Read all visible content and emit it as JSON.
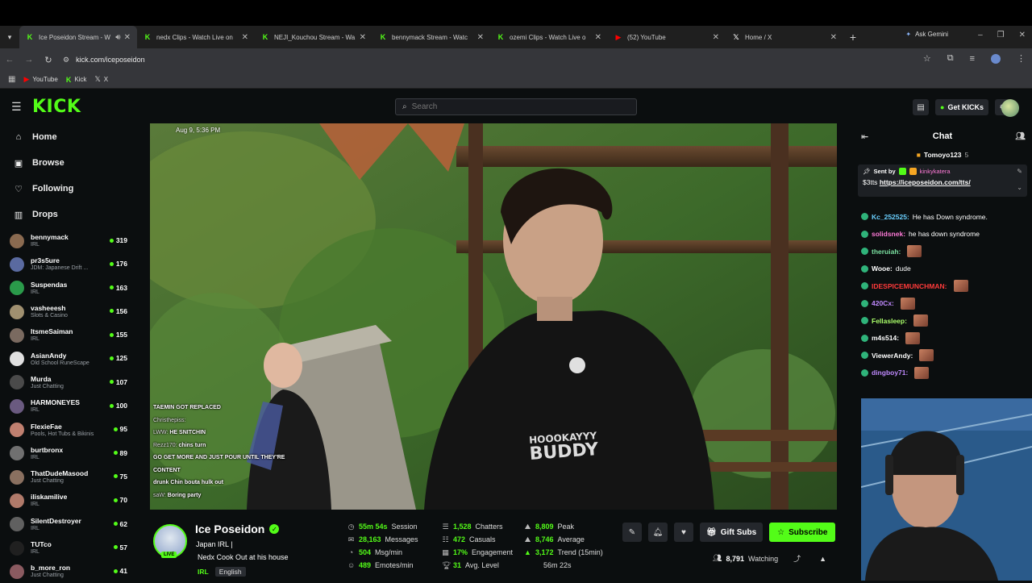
{
  "browser": {
    "tabs": [
      {
        "title": "Ice Poseidon Stream - W",
        "favicon": "kick-icon",
        "color": "#53fc18",
        "active": true
      },
      {
        "title": "nedx Clips - Watch Live on",
        "favicon": "kick-icon",
        "color": "#53fc18",
        "active": false
      },
      {
        "title": "NEJI_Kouchou Stream - Wa",
        "favicon": "kick-icon",
        "color": "#53fc18",
        "active": false
      },
      {
        "title": "bennymack Stream - Watc",
        "favicon": "kick-icon",
        "color": "#53fc18",
        "active": false
      },
      {
        "title": "ozemi Clips - Watch Live o",
        "favicon": "kick-icon",
        "color": "#53fc18",
        "active": false
      },
      {
        "title": "(52) YouTube",
        "favicon": "youtube-icon",
        "color": "#ff0000",
        "active": false
      },
      {
        "title": "Home / X",
        "favicon": "x-icon",
        "color": "#ffffff",
        "active": false
      }
    ],
    "ask_label": "Ask Gemini",
    "url": "kick.com/iceposeidon",
    "bookmarks": [
      "YouTube",
      "Kick",
      "X"
    ]
  },
  "kick": {
    "logo": "KICK",
    "search_placeholder": "Search",
    "get_kicks": "Get KICKs"
  },
  "sidebar": {
    "nav": [
      {
        "label": "Home",
        "icon": "home-icon"
      },
      {
        "label": "Browse",
        "icon": "browse-icon"
      },
      {
        "label": "Following",
        "icon": "heart-icon"
      },
      {
        "label": "Drops",
        "icon": "drops-icon"
      }
    ],
    "channels": [
      {
        "name": "bennymack",
        "category": "IRL",
        "viewers": "319",
        "color": "#8a6a50"
      },
      {
        "name": "pr3s5ure",
        "category": "JDM: Japanese Drift ...",
        "viewers": "176",
        "color": "#5a6aa0"
      },
      {
        "name": "Suspendas",
        "category": "IRL",
        "viewers": "163",
        "color": "#2a9a4a"
      },
      {
        "name": "vasheeesh",
        "category": "Slots & Casino",
        "viewers": "156",
        "color": "#a09070"
      },
      {
        "name": "ItsmeSaiman",
        "category": "IRL",
        "viewers": "155",
        "color": "#7a6a60"
      },
      {
        "name": "AsianAndy",
        "category": "Old School RuneScape",
        "viewers": "125",
        "color": "#e0e0e0"
      },
      {
        "name": "Murda",
        "category": "Just Chatting",
        "viewers": "107",
        "color": "#4a4a4a"
      },
      {
        "name": "HARMONEYES",
        "category": "IRL",
        "viewers": "100",
        "color": "#6a5a80"
      },
      {
        "name": "FlexieFae",
        "category": "Pools, Hot Tubs & Bikinis",
        "viewers": "95",
        "color": "#c08070"
      },
      {
        "name": "burtbronx",
        "category": "IRL",
        "viewers": "89",
        "color": "#707070"
      },
      {
        "name": "ThatDudeMasood",
        "category": "Just Chatting",
        "viewers": "75",
        "color": "#8a7060"
      },
      {
        "name": "iliskamilive",
        "category": "IRL",
        "viewers": "70",
        "color": "#b07a6a"
      },
      {
        "name": "SilentDestroyer",
        "category": "IRL",
        "viewers": "62",
        "color": "#606060"
      },
      {
        "name": "TUTco",
        "category": "IRL",
        "viewers": "57",
        "color": "#202020"
      },
      {
        "name": "b_more_ron",
        "category": "Just Chatting",
        "viewers": "41",
        "color": "#8a5a60"
      }
    ]
  },
  "player": {
    "timestamp": "Aug 9, 5:36 PM",
    "shirt_line1": "HOOOKAYYY",
    "shirt_line2": "BUDDY",
    "overlay_chat": [
      {
        "user": "",
        "text": "TAEMIN GOT REPLACED"
      },
      {
        "user": "Christhepiss:",
        "text": ""
      },
      {
        "user": "LWW:",
        "text": "HE SNITCHIN"
      },
      {
        "user": "Rezz170:",
        "text": "chins turn"
      },
      {
        "user": "",
        "text": "GO GET MORE AND JUST POUR UNTIL THEY'RE"
      },
      {
        "user": "",
        "text": "CONTENT"
      },
      {
        "user": "",
        "text": "drunk Chin bouta hulk out"
      },
      {
        "user": "saW:",
        "text": "Boring party"
      }
    ]
  },
  "stream": {
    "name": "Ice Poseidon",
    "live_badge": "LIVE",
    "title_line1": "Japan IRL |",
    "title_line2": "Nedx Cook Out at his house",
    "tags": [
      "IRL",
      "English"
    ],
    "stats_col1": [
      {
        "value": "55m 54s",
        "label": "Session",
        "icon": "clock-icon"
      },
      {
        "value": "28,163",
        "label": "Messages",
        "icon": "message-icon"
      },
      {
        "value": "504",
        "label": "Msg/min",
        "icon": "speed-icon"
      },
      {
        "value": "489",
        "label": "Emotes/min",
        "icon": "emote-icon"
      }
    ],
    "stats_col2": [
      {
        "value": "1,528",
        "label": "Chatters",
        "icon": "chatters-icon"
      },
      {
        "value": "472",
        "label": "Casuals",
        "icon": "casuals-icon"
      },
      {
        "value": "17%",
        "label": "Engagement",
        "icon": "engagement-icon"
      },
      {
        "value": "31",
        "label": "Avg. Level",
        "icon": "trophy-icon"
      }
    ],
    "stats_col3": [
      {
        "value": "8,809",
        "label": "Peak",
        "icon": "peak-icon"
      },
      {
        "value": "8,746",
        "label": "Average",
        "icon": "average-icon"
      },
      {
        "value": "3,172",
        "label": "Trend (15min)",
        "icon": "trend-icon"
      },
      {
        "value": "",
        "label": "56m 22s",
        "icon": ""
      }
    ],
    "gift_subs": "Gift Subs",
    "subscribe": "Subscribe",
    "watching_count": "8,791",
    "watching_label": "Watching"
  },
  "chat": {
    "title": "Chat",
    "pinned_user": "Tomoyo123",
    "pinned_count": "5",
    "sent_by_label": "Sent by",
    "sent_by_user": "kinkykatera",
    "tts_prefix": "$3tts",
    "tts_link": "https://iceposeidon.com/tts/",
    "messages": [
      {
        "user": "Kc_252525:",
        "text": "He has Down syndrome.",
        "color": "#6ad0ff",
        "emote": false
      },
      {
        "user": "solidsnek:",
        "text": "he has down syndrome",
        "color": "#ff7ad8",
        "emote": false
      },
      {
        "user": "theruiah:",
        "text": "",
        "color": "#7ae0a0",
        "emote": true
      },
      {
        "user": "Wooe:",
        "text": "dude",
        "color": "#ffffff",
        "emote": false
      },
      {
        "user": "IDESPICEMUNCHMAN:",
        "text": "",
        "color": "#ff3a3a",
        "emote": true
      },
      {
        "user": "420Cx:",
        "text": "",
        "color": "#c08aff",
        "emote": true
      },
      {
        "user": "Fellasleep:",
        "text": "",
        "color": "#aaff6a",
        "emote": true
      },
      {
        "user": "m4s514:",
        "text": "",
        "color": "#ffffff",
        "emote": true
      },
      {
        "user": "ViewerAndy:",
        "text": "",
        "color": "#ffffff",
        "emote": true
      },
      {
        "user": "dingboy71:",
        "text": "",
        "color": "#c08aff",
        "emote": true
      }
    ]
  }
}
